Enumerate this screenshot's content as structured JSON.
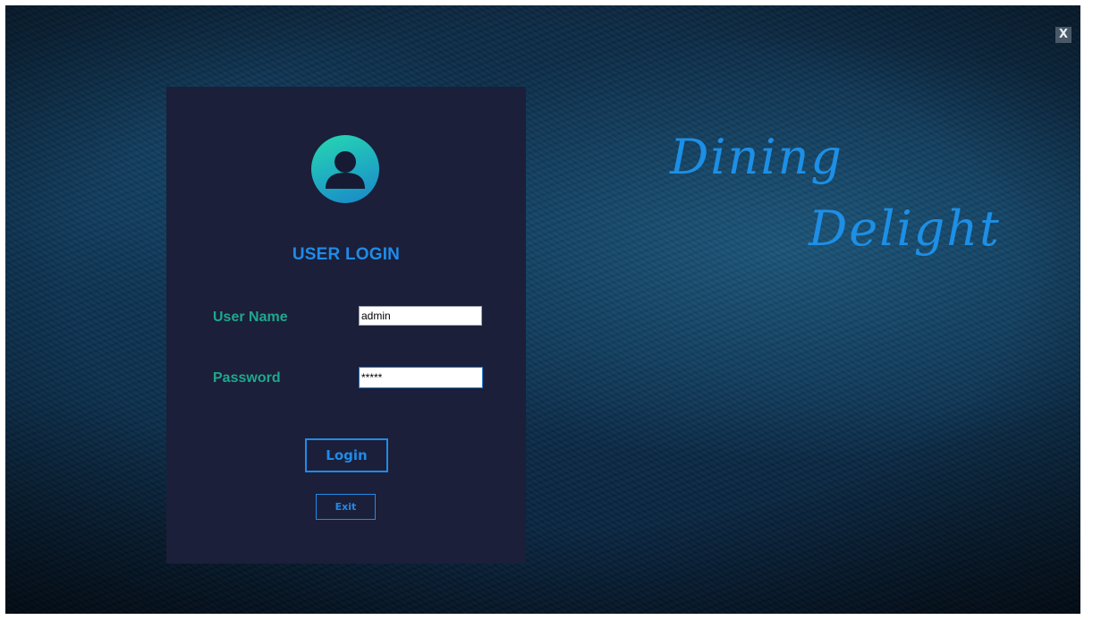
{
  "window": {
    "close_label": "X"
  },
  "login": {
    "title": "USER LOGIN",
    "username_label": "User Name",
    "username_value": "admin",
    "password_label": "Password",
    "password_value": "*****",
    "login_button": "Login",
    "exit_button": "Exit",
    "avatar_icon": "user-avatar-icon"
  },
  "brand": {
    "line1": "Dining",
    "line2": "Delight"
  },
  "colors": {
    "accent_blue": "#1f8be8",
    "label_teal": "#1ea88e",
    "panel_bg": "#1b1f39"
  }
}
